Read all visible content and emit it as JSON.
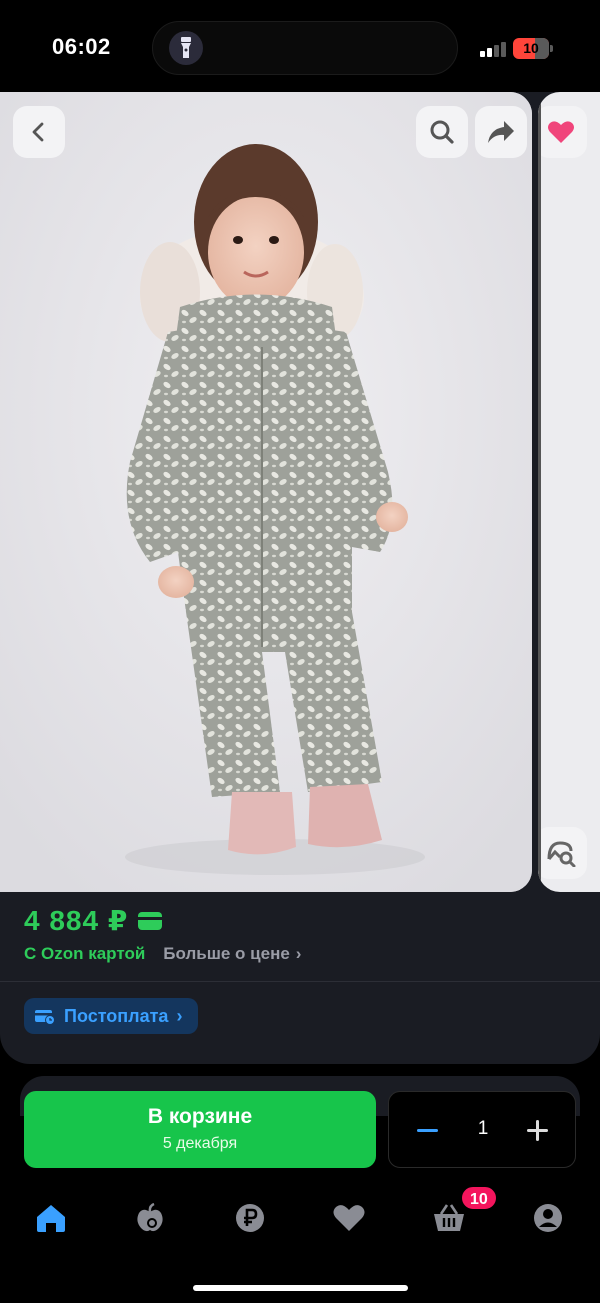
{
  "status_bar": {
    "time": "06:02",
    "battery": "10",
    "icons": [
      "flashlight-icon",
      "signal-icon",
      "battery-icon"
    ]
  },
  "gallery": {
    "image": "photo of a toddler girl in a grey floral winter jumpsuit with fur hood and pink boots",
    "buttons": [
      "back-icon",
      "search-icon",
      "share-icon",
      "heart-icon",
      "image-search-icon"
    ]
  },
  "price": {
    "value": "4 884 ₽",
    "ozon_card": "С Ozon картой",
    "more": "Больше о цене",
    "chevron": "›"
  },
  "postpay": {
    "label": "Постоплата",
    "chevron": "›"
  },
  "cart": {
    "title": "В корзине",
    "date": "5 декабря",
    "quantity": "1"
  },
  "tabbar": {
    "items": [
      "home-icon",
      "fresh-icon",
      "finance-icon",
      "favorites-icon",
      "cart-icon",
      "profile-icon"
    ],
    "cart_badge": "10"
  },
  "colors": {
    "accent_green": "#2ecc5a",
    "button_green": "#17c54b",
    "link_blue": "#3aa0ff",
    "badge_pink": "#f4155d",
    "favorite_pink": "#f0457b",
    "card_bg": "#1a1c23"
  }
}
